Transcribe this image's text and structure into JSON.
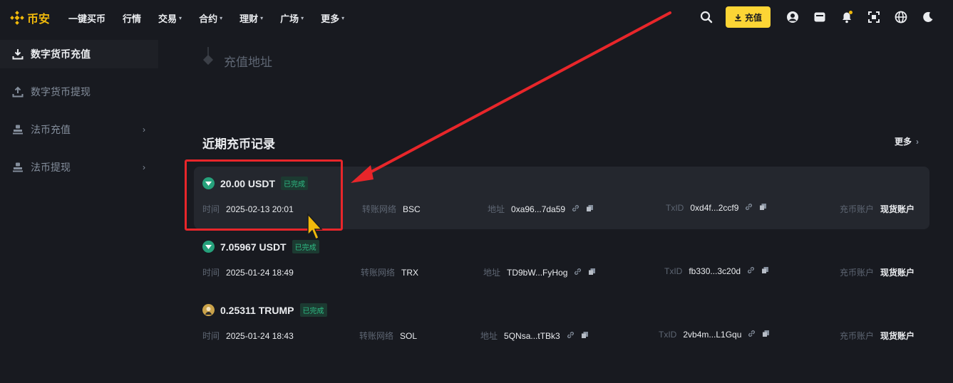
{
  "brand": {
    "name": "币安",
    "color": "#f0b90b"
  },
  "nav": {
    "items": [
      {
        "label": "一键买币",
        "dropdown": false
      },
      {
        "label": "行情",
        "dropdown": false
      },
      {
        "label": "交易",
        "dropdown": true
      },
      {
        "label": "合约",
        "dropdown": true
      },
      {
        "label": "理财",
        "dropdown": true
      },
      {
        "label": "广场",
        "dropdown": true
      },
      {
        "label": "更多",
        "dropdown": true
      }
    ],
    "deposit_label": "充值",
    "right_icons": [
      "search-icon",
      "profile-icon",
      "wallet-icon",
      "bell-icon",
      "download-icon",
      "globe-icon",
      "moon-icon"
    ]
  },
  "sidebar": {
    "items": [
      {
        "label": "数字货币充值",
        "active": true,
        "icon": "download-icon",
        "chevron": false
      },
      {
        "label": "数字货币提现",
        "active": false,
        "icon": "upload-icon",
        "chevron": false
      },
      {
        "label": "法币充值",
        "active": false,
        "icon": "bank-icon",
        "chevron": true
      },
      {
        "label": "法币提现",
        "active": false,
        "icon": "bank-icon",
        "chevron": true
      }
    ]
  },
  "main": {
    "step_label": "充值地址",
    "section_title": "近期充币记录",
    "more_label": "更多"
  },
  "labels": {
    "time": "时间",
    "network": "转账网络",
    "address": "地址",
    "txid": "TxID",
    "account": "充币账户"
  },
  "records": [
    {
      "amount": "20.00 USDT",
      "status": "已完成",
      "coin": "usdt",
      "time": "2025-02-13 20:01",
      "network": "BSC",
      "address": "0xa96...7da59",
      "txid": "0xd4f...2ccf9",
      "account": "现货账户"
    },
    {
      "amount": "7.05967 USDT",
      "status": "已完成",
      "coin": "usdt",
      "time": "2025-01-24 18:49",
      "network": "TRX",
      "address": "TD9bW...FyHog",
      "txid": "fb330...3c20d",
      "account": "现货账户"
    },
    {
      "amount": "0.25311 TRUMP",
      "status": "已完成",
      "coin": "trump",
      "time": "2025-01-24 18:43",
      "network": "SOL",
      "address": "5QNsa...tTBk3",
      "txid": "2vb4m...L1Gqu",
      "account": "现货账户"
    }
  ],
  "colors": {
    "accent": "#fcd535",
    "success": "#2ebd85",
    "annotation": "#e8262a"
  }
}
